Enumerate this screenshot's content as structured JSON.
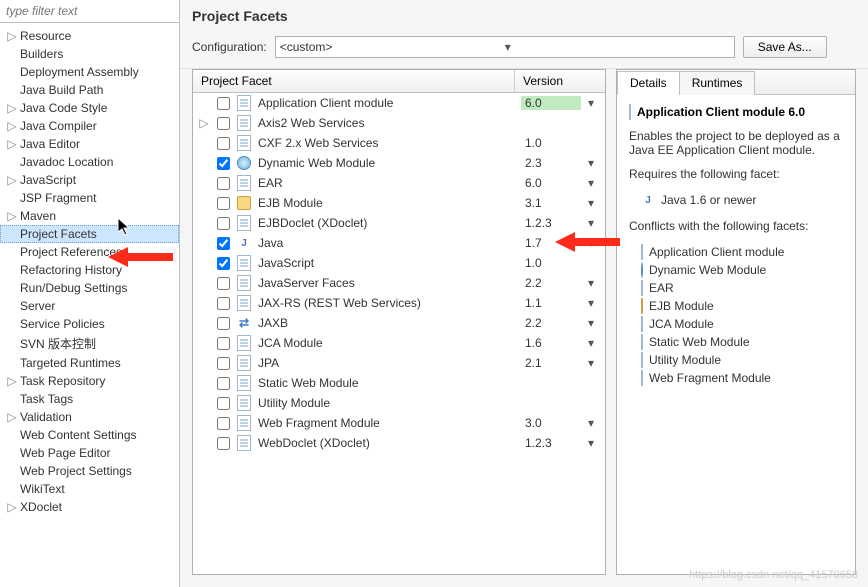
{
  "filter_placeholder": "type filter text",
  "sidebar": [
    {
      "label": "Resource",
      "expand": true,
      "indent": 0
    },
    {
      "label": "Builders",
      "expand": false,
      "indent": 0
    },
    {
      "label": "Deployment Assembly",
      "expand": false,
      "indent": 0
    },
    {
      "label": "Java Build Path",
      "expand": false,
      "indent": 0
    },
    {
      "label": "Java Code Style",
      "expand": true,
      "indent": 0
    },
    {
      "label": "Java Compiler",
      "expand": true,
      "indent": 0
    },
    {
      "label": "Java Editor",
      "expand": true,
      "indent": 0
    },
    {
      "label": "Javadoc Location",
      "expand": false,
      "indent": 0
    },
    {
      "label": "JavaScript",
      "expand": true,
      "indent": 0
    },
    {
      "label": "JSP Fragment",
      "expand": false,
      "indent": 0
    },
    {
      "label": "Maven",
      "expand": true,
      "indent": 0
    },
    {
      "label": "Project Facets",
      "expand": false,
      "indent": 0,
      "selected": true
    },
    {
      "label": "Project References",
      "expand": false,
      "indent": 0
    },
    {
      "label": "Refactoring History",
      "expand": false,
      "indent": 0
    },
    {
      "label": "Run/Debug Settings",
      "expand": false,
      "indent": 0
    },
    {
      "label": "Server",
      "expand": false,
      "indent": 0
    },
    {
      "label": "Service Policies",
      "expand": false,
      "indent": 0
    },
    {
      "label": "SVN 版本控制",
      "expand": false,
      "indent": 0
    },
    {
      "label": "Targeted Runtimes",
      "expand": false,
      "indent": 0
    },
    {
      "label": "Task Repository",
      "expand": true,
      "indent": 0
    },
    {
      "label": "Task Tags",
      "expand": false,
      "indent": 0
    },
    {
      "label": "Validation",
      "expand": true,
      "indent": 0
    },
    {
      "label": "Web Content Settings",
      "expand": false,
      "indent": 0
    },
    {
      "label": "Web Page Editor",
      "expand": false,
      "indent": 0
    },
    {
      "label": "Web Project Settings",
      "expand": false,
      "indent": 0
    },
    {
      "label": "WikiText",
      "expand": false,
      "indent": 0
    },
    {
      "label": "XDoclet",
      "expand": true,
      "indent": 0
    }
  ],
  "page_title": "Project Facets",
  "config_label": "Configuration:",
  "config_value": "<custom>",
  "save_as_label": "Save As...",
  "table_header_name": "Project Facet",
  "table_header_ver": "Version",
  "facets": [
    {
      "name": "Application Client module",
      "ver": "6.0",
      "checked": false,
      "expand": "none",
      "icon": "doc",
      "hl": true,
      "caret": true
    },
    {
      "name": "Axis2 Web Services",
      "ver": "",
      "checked": false,
      "expand": "closed",
      "icon": "doc"
    },
    {
      "name": "CXF 2.x Web Services",
      "ver": "1.0",
      "checked": false,
      "expand": "none",
      "icon": "doc"
    },
    {
      "name": "Dynamic Web Module",
      "ver": "2.3",
      "checked": true,
      "expand": "none",
      "icon": "globe",
      "caret": true
    },
    {
      "name": "EAR",
      "ver": "6.0",
      "checked": false,
      "expand": "none",
      "icon": "doc",
      "caret": true
    },
    {
      "name": "EJB Module",
      "ver": "3.1",
      "checked": false,
      "expand": "none",
      "icon": "jar",
      "caret": true
    },
    {
      "name": "EJBDoclet (XDoclet)",
      "ver": "1.2.3",
      "checked": false,
      "expand": "none",
      "icon": "doc",
      "caret": true
    },
    {
      "name": "Java",
      "ver": "1.7",
      "checked": true,
      "expand": "none",
      "icon": "java",
      "caret": true
    },
    {
      "name": "JavaScript",
      "ver": "1.0",
      "checked": true,
      "expand": "none",
      "icon": "doc"
    },
    {
      "name": "JavaServer Faces",
      "ver": "2.2",
      "checked": false,
      "expand": "none",
      "icon": "doc",
      "caret": true
    },
    {
      "name": "JAX-RS (REST Web Services)",
      "ver": "1.1",
      "checked": false,
      "expand": "none",
      "icon": "doc",
      "caret": true
    },
    {
      "name": "JAXB",
      "ver": "2.2",
      "checked": false,
      "expand": "none",
      "icon": "arrows",
      "caret": true
    },
    {
      "name": "JCA Module",
      "ver": "1.6",
      "checked": false,
      "expand": "none",
      "icon": "doc",
      "caret": true
    },
    {
      "name": "JPA",
      "ver": "2.1",
      "checked": false,
      "expand": "none",
      "icon": "doc",
      "caret": true
    },
    {
      "name": "Static Web Module",
      "ver": "",
      "checked": false,
      "expand": "none",
      "icon": "doc"
    },
    {
      "name": "Utility Module",
      "ver": "",
      "checked": false,
      "expand": "none",
      "icon": "doc"
    },
    {
      "name": "Web Fragment Module",
      "ver": "3.0",
      "checked": false,
      "expand": "none",
      "icon": "doc",
      "caret": true
    },
    {
      "name": "WebDoclet (XDoclet)",
      "ver": "1.2.3",
      "checked": false,
      "expand": "none",
      "icon": "doc",
      "caret": true
    }
  ],
  "tabs": {
    "details": "Details",
    "runtimes": "Runtimes"
  },
  "details": {
    "title": "Application Client module 6.0",
    "desc": "Enables the project to be deployed as a Java EE Application Client module.",
    "requires_label": "Requires the following facet:",
    "requires": [
      {
        "icon": "java",
        "label": "Java 1.6 or newer"
      }
    ],
    "conflicts_label": "Conflicts with the following facets:",
    "conflicts": [
      {
        "icon": "doc",
        "label": "Application Client module"
      },
      {
        "icon": "globe",
        "label": "Dynamic Web Module"
      },
      {
        "icon": "doc",
        "label": "EAR"
      },
      {
        "icon": "jar",
        "label": "EJB Module"
      },
      {
        "icon": "doc",
        "label": "JCA Module"
      },
      {
        "icon": "doc",
        "label": "Static Web Module"
      },
      {
        "icon": "doc",
        "label": "Utility Module"
      },
      {
        "icon": "doc",
        "label": "Web Fragment Module"
      }
    ]
  },
  "watermark": "https://blog.csdn.net/qq_41570658"
}
